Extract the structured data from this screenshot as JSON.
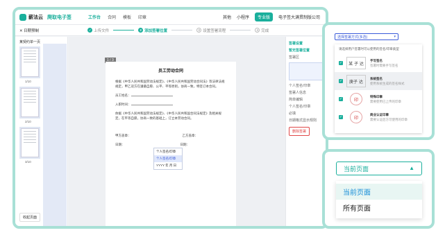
{
  "header": {
    "app_name": "薪法云",
    "product": "爬取电子签",
    "nav": [
      "工作台",
      "合同",
      "模板",
      "印章"
    ],
    "right": [
      "其他",
      "小程序",
      "专业版",
      "电子签大满贯制版公司"
    ]
  },
  "stepbar": {
    "back": "日期预制",
    "steps": [
      "上传文件",
      "添加签署位置",
      "设置签署流程",
      "完成"
    ]
  },
  "left_panel": {
    "title": "某契约单一页",
    "page_labels": [
      "1/10",
      "2/10",
      "3/10"
    ],
    "bottom_button": "收起页面"
  },
  "doc": {
    "page_badge": "1 / 3",
    "title": "员工劳动合同",
    "intro": "根据《中华人民共和国劳动法规定》、《中华人民共和国劳动合同法》等法律法规规定，甲乙双方在遵循自愿、公平、平等原则，协商一致，特签订本合同。",
    "field_name": "员工姓名：",
    "field_date": "入职时间：",
    "clause": "依据《中华人民共和国劳动法规定》、《中华人民共和国合同法规定》及相关规定，在平等自愿，协商一致的基础上，订立本劳动合同。",
    "party_a": "甲方盖章：",
    "party_b": "乙方盖章：",
    "date_a": "日期：",
    "date_b": "日期：",
    "sig_popup": [
      "个人签名/印章",
      "个人签名/印章",
      "YYYY 年 月 日"
    ]
  },
  "right_panel": {
    "title": "签署设置",
    "section1": "暂无签署位置",
    "section2": "签署区",
    "personal": "个人签名/印章",
    "section3": "签署人信息",
    "section4": "简单编辑",
    "field_label": "个人签名/印章",
    "required": "必填",
    "hint": "日期格式显示规则",
    "delete_btn": "删除签署"
  },
  "popup_top": {
    "select_value": "选择签署方式(多选)",
    "description": "请选择用户签署时可以使用的签名/印章类型",
    "seals": [
      {
        "image_text": "某 子 达",
        "title": "手写签名",
        "desc": "签署时需要手写签名"
      },
      {
        "image_text": "庚子 达",
        "title": "系统签名",
        "desc": "使用系统生成的签名样式"
      },
      {
        "image_text": "印",
        "title": "特殊印章",
        "desc": "需要使用已上传的印章"
      },
      {
        "image_text": "印",
        "title": "商业认证印章",
        "desc": "需要认证后方可使用的印章"
      }
    ]
  },
  "popup_bottom": {
    "select_value": "当前页面",
    "options": [
      "当前页面",
      "所有页面"
    ]
  },
  "colors": {
    "accent": "#1aaf9c",
    "frame": "#a8e0d6",
    "link": "#3a5bd9",
    "danger": "#e04848"
  }
}
